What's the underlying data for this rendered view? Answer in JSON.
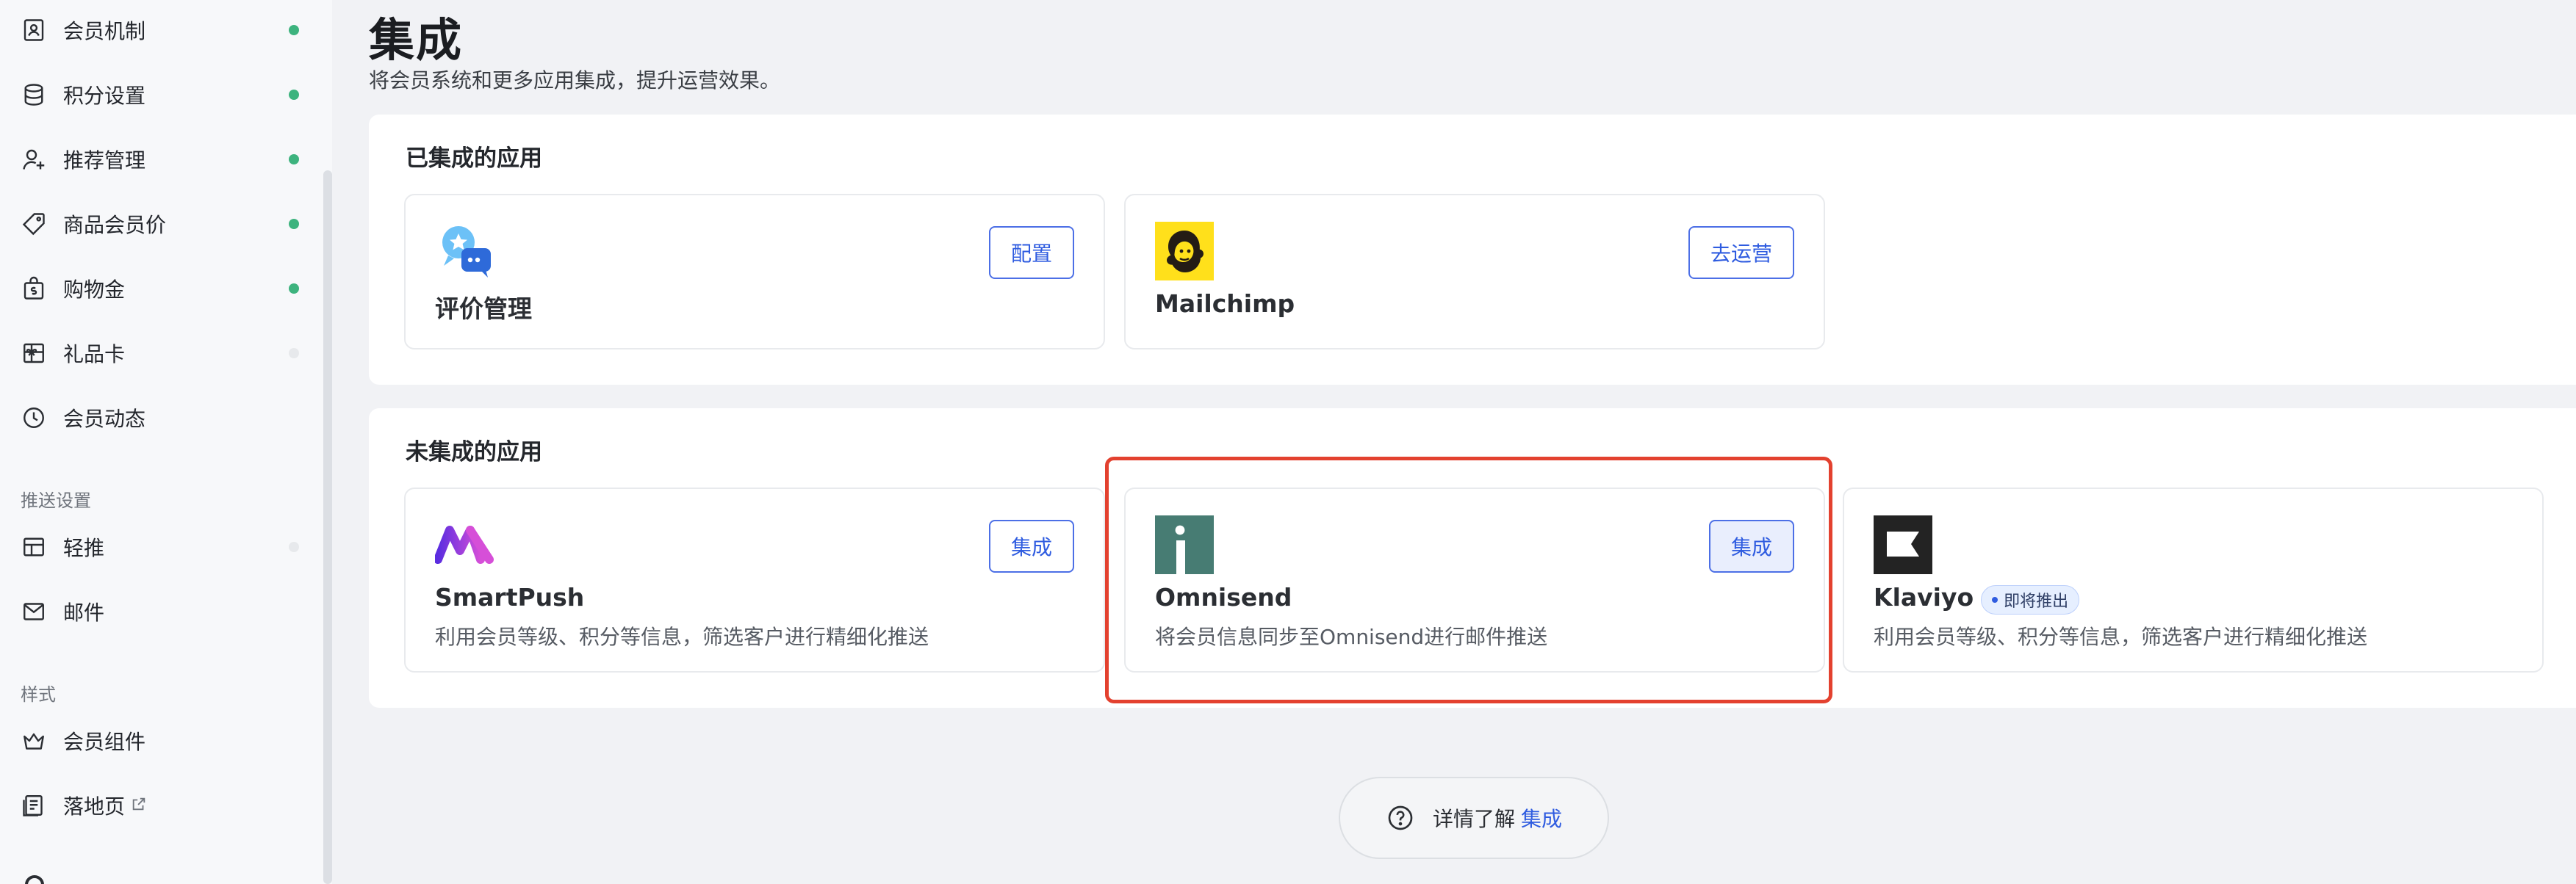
{
  "sidebar": {
    "items": [
      {
        "label": "会员机制",
        "icon": "membership-mechanism-icon",
        "status": "on"
      },
      {
        "label": "积分设置",
        "icon": "points-database-icon",
        "status": "on"
      },
      {
        "label": "推荐管理",
        "icon": "add-user-icon",
        "status": "on"
      },
      {
        "label": "商品会员价",
        "icon": "price-tag-icon",
        "status": "on"
      },
      {
        "label": "购物金",
        "icon": "shopping-credit-icon",
        "status": "on"
      },
      {
        "label": "礼品卡",
        "icon": "gift-card-icon",
        "status": "off"
      },
      {
        "label": "会员动态",
        "icon": "clock-icon",
        "status": "none"
      }
    ],
    "section_push": "推送设置",
    "push_items": [
      {
        "label": "轻推",
        "icon": "nudge-window-icon",
        "status": "off"
      },
      {
        "label": "邮件",
        "icon": "mail-icon",
        "status": "none"
      }
    ],
    "section_style": "样式",
    "style_items": [
      {
        "label": "会员组件",
        "icon": "crown-icon"
      },
      {
        "label": "落地页",
        "icon": "landing-page-icon",
        "external": true
      }
    ]
  },
  "header": {
    "title": "集成",
    "subtitle": "将会员系统和更多应用集成，提升运营效果。"
  },
  "integrated": {
    "title": "已集成的应用",
    "apps": [
      {
        "name": "评价管理",
        "button": "配置",
        "logo": "review-chat-icon"
      },
      {
        "name": "Mailchimp",
        "button": "去运营",
        "logo": "mailchimp-logo-icon"
      }
    ]
  },
  "not_integrated": {
    "title": "未集成的应用",
    "apps": [
      {
        "name": "SmartPush",
        "desc": "利用会员等级、积分等信息，筛选客户进行精细化推送",
        "button": "集成",
        "logo": "smartpush-logo-icon"
      },
      {
        "name": "Omnisend",
        "desc": "将会员信息同步至Omnisend进行邮件推送",
        "button": "集成",
        "logo": "omnisend-logo-icon"
      },
      {
        "name": "Klaviyo",
        "desc": "利用会员等级、积分等信息，筛选客户进行精细化推送",
        "badge": "即将推出",
        "logo": "klaviyo-logo-icon"
      }
    ]
  },
  "learn_more": {
    "text": "详情了解",
    "link": "集成"
  },
  "colors": {
    "accent": "#2f5ce0",
    "status_on": "#3db37e",
    "highlight": "#e3412f"
  }
}
